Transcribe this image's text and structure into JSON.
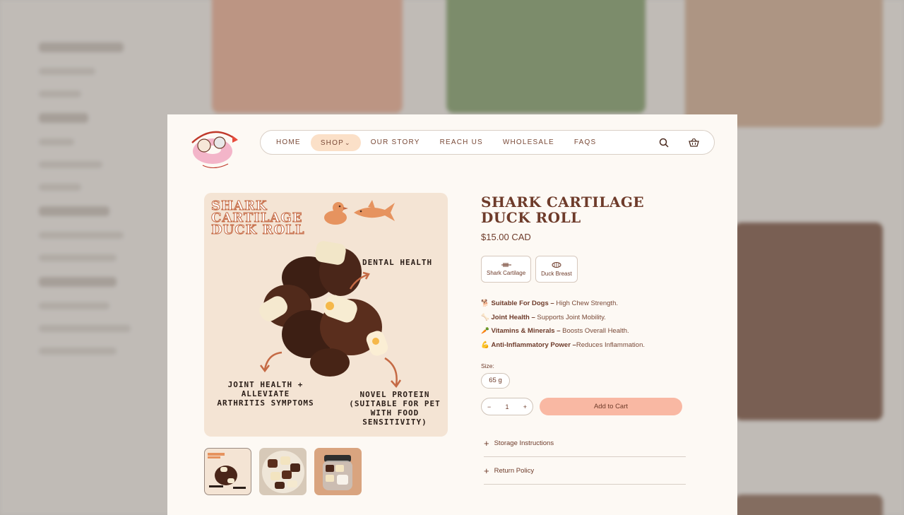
{
  "nav": {
    "items": [
      {
        "label": "HOME"
      },
      {
        "label": "SHOP"
      },
      {
        "label": "OUR STORY"
      },
      {
        "label": "REACH US"
      },
      {
        "label": "WHOLESALE"
      },
      {
        "label": "FAQS"
      }
    ],
    "icons": [
      "search-icon",
      "basket-icon"
    ]
  },
  "product": {
    "title_line1": "SHARK CARTILAGE",
    "title_line2": "DUCK ROLL",
    "price": "$15.00 CAD",
    "ingredients": [
      {
        "label": "Shark Cartilage",
        "icon": "fishbone-icon"
      },
      {
        "label": "Duck Breast",
        "icon": "duck-breast-icon"
      }
    ],
    "features": [
      {
        "emoji": "🐕",
        "bold": "Suitable For Dogs –",
        "text": " High Chew Strength."
      },
      {
        "emoji": "🦴",
        "bold": "Joint Health –",
        "text": " Supports Joint Mobility."
      },
      {
        "emoji": "🥕",
        "bold": "Vitamins & Minerals –",
        "text": " Boosts Overall Health."
      },
      {
        "emoji": "💪",
        "bold": "Anti-Inflammatory Power –",
        "text": "Reduces Inflammation."
      }
    ],
    "size_label": "Size:",
    "size_value": "65 g",
    "quantity": "1",
    "qty_minus": "−",
    "qty_plus": "+",
    "add_to_cart": "Add to Cart",
    "accordions": [
      {
        "label": "Storage Instructions"
      },
      {
        "label": "Return Policy"
      }
    ]
  },
  "image": {
    "title_l1": "SHARK",
    "title_l2": "CARTILAGE",
    "title_l3": "DUCK ROLL",
    "label_dental": "DENTAL HEALTH",
    "label_joint_l1": "JOINT HEALTH +",
    "label_joint_l2": "ALLEVIATE",
    "label_joint_l3": "ARTHRITIS SYMPTOMS",
    "label_novel_l1": "NOVEL PROTEIN",
    "label_novel_l2": "(SUITABLE FOR PET",
    "label_novel_l3": "WITH FOOD",
    "label_novel_l4": "SENSITIVITY)"
  },
  "colors": {
    "accent": "#f9b8a3",
    "brand_brown": "#6e3b2a",
    "active_nav": "#fbe0c8"
  }
}
